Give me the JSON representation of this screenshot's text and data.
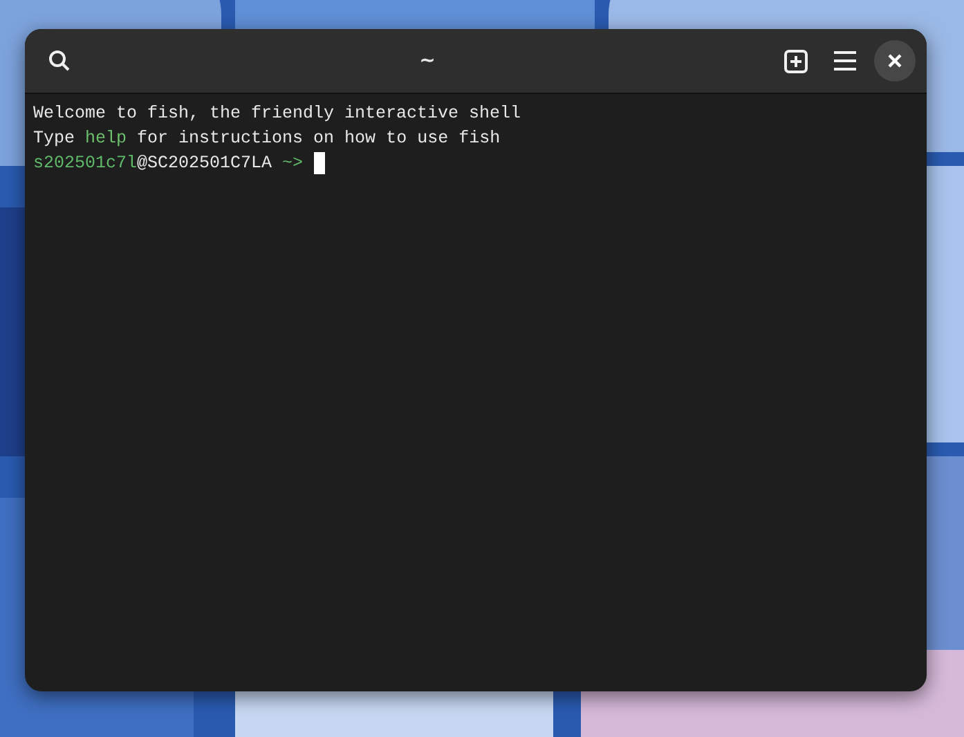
{
  "window": {
    "title": "~"
  },
  "terminal": {
    "lines": [
      {
        "segments": [
          {
            "text": "Welcome to fish, the friendly interactive shell",
            "color": "#e8e8e8"
          }
        ]
      },
      {
        "segments": [
          {
            "text": "Type ",
            "color": "#e8e8e8"
          },
          {
            "text": "help",
            "color": "#6cbf6c"
          },
          {
            "text": " for instructions on how to use fish",
            "color": "#e8e8e8"
          }
        ]
      },
      {
        "segments": [
          {
            "text": "s202501c7l",
            "color": "#5fba6a"
          },
          {
            "text": "@SC202501C7LA",
            "color": "#e8e8e8"
          },
          {
            "text": " ~>",
            "color": "#5fba6a"
          }
        ],
        "cursor": true
      }
    ]
  }
}
